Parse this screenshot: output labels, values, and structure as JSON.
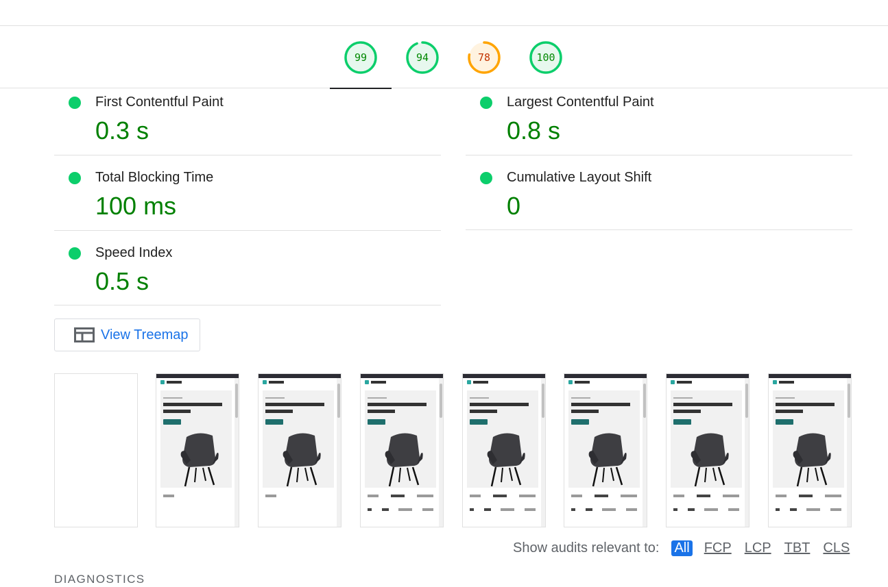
{
  "gauges": [
    {
      "score": "99",
      "value": 0.99,
      "color": "#0cce6b",
      "fill": "#e7f8ee",
      "text_color": "#008800",
      "active": true
    },
    {
      "score": "94",
      "value": 0.94,
      "color": "#0cce6b",
      "fill": "#e7f8ee",
      "text_color": "#008800",
      "active": false
    },
    {
      "score": "78",
      "value": 0.78,
      "color": "#ffa400",
      "fill": "#fff3e0",
      "text_color": "#c33300",
      "active": false
    },
    {
      "score": "100",
      "value": 1.0,
      "color": "#0cce6b",
      "fill": "#e7f8ee",
      "text_color": "#008800",
      "active": false
    }
  ],
  "metrics": [
    {
      "label": "First Contentful Paint",
      "value": "0.3 s"
    },
    {
      "label": "Largest Contentful Paint",
      "value": "0.8 s"
    },
    {
      "label": "Total Blocking Time",
      "value": "100 ms"
    },
    {
      "label": "Cumulative Layout Shift",
      "value": "0"
    },
    {
      "label": "Speed Index",
      "value": "0.5 s"
    }
  ],
  "treemap": {
    "label": "View Treemap",
    "icon": "treemap-icon"
  },
  "filmstrip": {
    "frames": 8,
    "hero_title": "Comfort and Style Now in Every Chair!"
  },
  "filter": {
    "label": "Show audits relevant to:",
    "options": [
      "All",
      "FCP",
      "LCP",
      "TBT",
      "CLS"
    ],
    "selected": "All"
  },
  "sections": {
    "diagnostics": "DIAGNOSTICS"
  },
  "colors": {
    "pass": "#0cce6b",
    "average": "#ffa400",
    "accent": "#1a73e8",
    "metric_value": "#008000"
  }
}
